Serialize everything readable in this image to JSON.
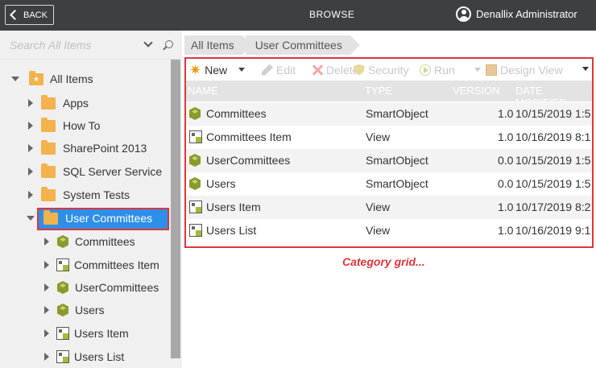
{
  "topbar": {
    "back_label": "BACK",
    "title": "BROWSE",
    "user_name": "Denallix Administrator"
  },
  "search": {
    "placeholder": "Search All Items"
  },
  "tree": {
    "root": {
      "label": "All Items",
      "expanded": true,
      "icon": "folder-star-icon"
    },
    "folders": [
      {
        "label": "Apps",
        "icon": "folder-icon"
      },
      {
        "label": "How To",
        "icon": "folder-icon"
      },
      {
        "label": "SharePoint 2013",
        "icon": "folder-icon"
      },
      {
        "label": "SQL Server Service",
        "icon": "folder-icon"
      },
      {
        "label": "System Tests",
        "icon": "folder-icon"
      },
      {
        "label": "User Committees",
        "icon": "folder-icon",
        "selected": true,
        "expanded": true
      }
    ],
    "children": [
      {
        "label": "Committees",
        "icon": "smartobject-icon"
      },
      {
        "label": "Committees Item",
        "icon": "view-icon"
      },
      {
        "label": "UserCommittees",
        "icon": "smartobject-icon"
      },
      {
        "label": "Users",
        "icon": "smartobject-icon"
      },
      {
        "label": "Users Item",
        "icon": "view-icon"
      },
      {
        "label": "Users List",
        "icon": "view-icon"
      }
    ]
  },
  "breadcrumb": [
    "All Items",
    "User Committees"
  ],
  "toolbar": {
    "new_label": "New",
    "edit_label": "Edit",
    "delete_label": "Delete",
    "security_label": "Security",
    "run_label": "Run",
    "design_view_label": "Design View"
  },
  "grid": {
    "columns": [
      "NAME",
      "TYPE",
      "VERSION",
      "DATE MODIFIED"
    ],
    "rows": [
      {
        "name": "Committees",
        "type": "SmartObject",
        "version": "1.0",
        "date": "10/15/2019 1:5",
        "icon": "smartobject-icon"
      },
      {
        "name": "Committees Item",
        "type": "View",
        "version": "1.0",
        "date": "10/16/2019 8:1",
        "icon": "view-icon"
      },
      {
        "name": "UserCommittees",
        "type": "SmartObject",
        "version": "0.0",
        "date": "10/15/2019 1:5",
        "icon": "smartobject-icon"
      },
      {
        "name": "Users",
        "type": "SmartObject",
        "version": "0.0",
        "date": "10/15/2019 1:5",
        "icon": "smartobject-icon"
      },
      {
        "name": "Users Item",
        "type": "View",
        "version": "1.0",
        "date": "10/17/2019 8:2",
        "icon": "view-icon"
      },
      {
        "name": "Users List",
        "type": "View",
        "version": "1.0",
        "date": "10/16/2019 9:1",
        "icon": "view-icon"
      }
    ]
  },
  "caption": "Category grid...",
  "colors": {
    "topbar_bg": "#3c4043",
    "highlight_red": "#e0353b",
    "selection_blue": "#2e8fe8",
    "folder_orange": "#f2b24c"
  }
}
